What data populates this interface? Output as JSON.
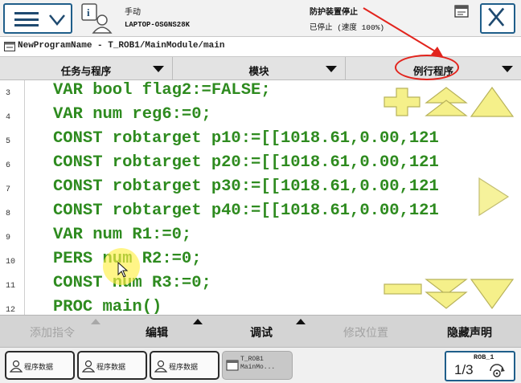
{
  "topbar": {
    "mode": "手动",
    "controller": "LAPTOP-OSGNS28K",
    "status_line1": "防护装置停止",
    "status_line2": "已停止 (速度 100%)"
  },
  "path": "NewProgramName - T_ROB1/MainModule/main",
  "tabs": {
    "tasks": "任务与程序",
    "module": "模块",
    "routine": "例行程序"
  },
  "code": {
    "lines": [
      {
        "no": "3",
        "text": "VAR bool flag2:=FALSE;"
      },
      {
        "no": "4",
        "text": "VAR num reg6:=0;"
      },
      {
        "no": "5",
        "text": "CONST robtarget p10:=[[1018.61,0.00,121"
      },
      {
        "no": "6",
        "text": "CONST robtarget p20:=[[1018.61,0.00,121"
      },
      {
        "no": "7",
        "text": "CONST robtarget p30:=[[1018.61,0.00,121"
      },
      {
        "no": "8",
        "text": "CONST robtarget p40:=[[1018.61,0.00,121"
      },
      {
        "no": "9",
        "text": "VAR num R1:=0;"
      },
      {
        "no": "10",
        "text": "PERS num R2:=0;"
      },
      {
        "no": "11",
        "text": "CONST num R3:=0;"
      },
      {
        "no": "12",
        "text": "PROC main()"
      }
    ]
  },
  "commands": {
    "add": "添加指令",
    "edit": "编辑",
    "debug": "调试",
    "modpos": "修改位置",
    "hide": "隐藏声明"
  },
  "taskbar": {
    "items": [
      {
        "label": "程序数据"
      },
      {
        "label": "程序数据"
      },
      {
        "label": "程序数据"
      },
      {
        "label_line1": "T_ROB1",
        "label_line2": "MainMo..."
      }
    ],
    "quickset": {
      "robot": "ROB_1",
      "speed": "1/3"
    }
  },
  "colors": {
    "code_text": "#2e8b1f",
    "nav_arrow_fill": "#f5f08a",
    "annotation": "#e2241d",
    "frame_blue": "#1f5e8a"
  },
  "icons": [
    "menu-icon",
    "chevron-down-icon",
    "user-info-icon",
    "status-icon",
    "close-icon",
    "program-icon",
    "program-data-icon",
    "gear-icon"
  ]
}
